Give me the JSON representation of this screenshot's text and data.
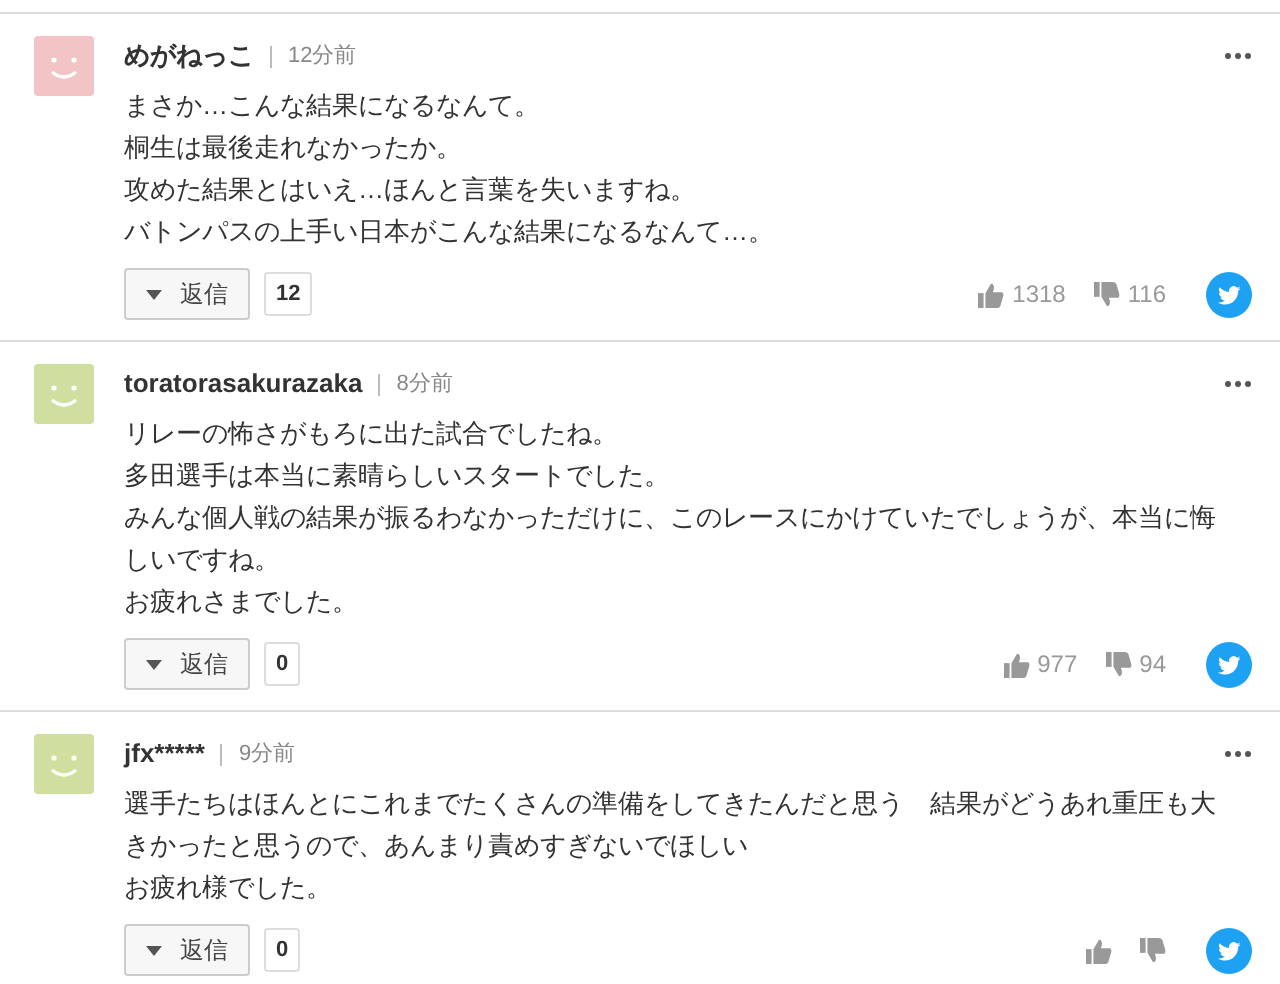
{
  "comments": [
    {
      "user": "めがねっこ",
      "time": "12分前",
      "color": "#f2c4c6",
      "lines": [
        "まさか…こんな結果になるなんて。",
        "桐生は最後走れなかったか。",
        "攻めた結果とはいえ…ほんと言葉を失いますね。",
        "バトンパスの上手い日本がこんな結果になるなんて…。"
      ],
      "reply_label": "返信",
      "reply_count": "12",
      "likes": "1318",
      "dislikes": "116"
    },
    {
      "user": "toratorasakurazaka",
      "time": "8分前",
      "color": "#cfdf9f",
      "lines": [
        "リレーの怖さがもろに出た試合でしたね。",
        "多田選手は本当に素晴らしいスタートでした。",
        "みんな個人戦の結果が振るわなかっただけに、このレースにかけていたでしょうが、本当に悔しいですね。",
        "お疲れさまでした。"
      ],
      "reply_label": "返信",
      "reply_count": "0",
      "likes": "977",
      "dislikes": "94"
    },
    {
      "user": "jfx*****",
      "time": "9分前",
      "color": "#cfdf9f",
      "lines": [
        "選手たちはほんとにこれまでたくさんの準備をしてきたんだと思う　結果がどうあれ重圧も大きかったと思うので、あんまり責めすぎないでほしい",
        "お疲れ様でした。"
      ],
      "reply_label": "返信",
      "reply_count": "0"
    }
  ]
}
